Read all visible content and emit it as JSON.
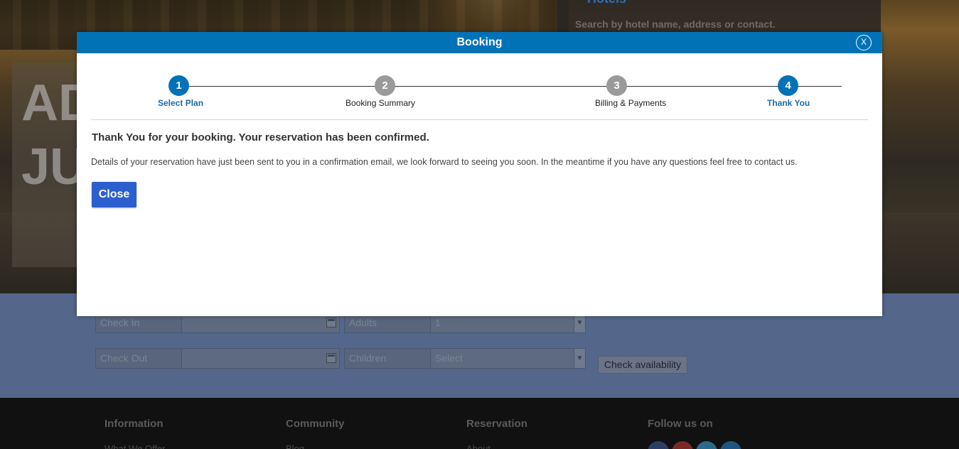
{
  "background": {
    "hero_text_line1": "AD",
    "hero_text_line2": "JU",
    "search_heading": "Hotels",
    "search_hint": "Search by hotel name, address or contact.",
    "form": {
      "check_in_placeholder": "Check In",
      "check_out_placeholder": "Check Out",
      "adults_label": "Adults",
      "adults_value": "1",
      "children_label": "Children",
      "children_value": "Select",
      "check_availability_label": "Check availability"
    },
    "footer": {
      "columns": [
        {
          "title": "Information",
          "link": "What We Offer"
        },
        {
          "title": "Community",
          "link": "Blog"
        },
        {
          "title": "Reservation",
          "link": "About"
        },
        {
          "title": "Follow us on",
          "link": ""
        }
      ]
    }
  },
  "modal": {
    "title": "Booking",
    "close_icon_label": "X",
    "steps": [
      {
        "number": "1",
        "label": "Select Plan",
        "state": "active"
      },
      {
        "number": "2",
        "label": "Booking Summary",
        "state": "inactive"
      },
      {
        "number": "3",
        "label": "Billing & Payments",
        "state": "inactive"
      },
      {
        "number": "4",
        "label": "Thank You",
        "state": "active"
      }
    ],
    "confirm_title": "Thank You for your booking. Your reservation has been confirmed.",
    "confirm_text": "Details of your reservation have just been sent to you in a confirmation email, we look forward to seeing you soon. In the meantime if you have any questions feel free to contact us.",
    "close_button_label": "Close"
  },
  "colors": {
    "header_blue": "#0272b7",
    "close_button_blue": "#2b5fcd",
    "inactive_step_gray": "#9a9a9a"
  }
}
